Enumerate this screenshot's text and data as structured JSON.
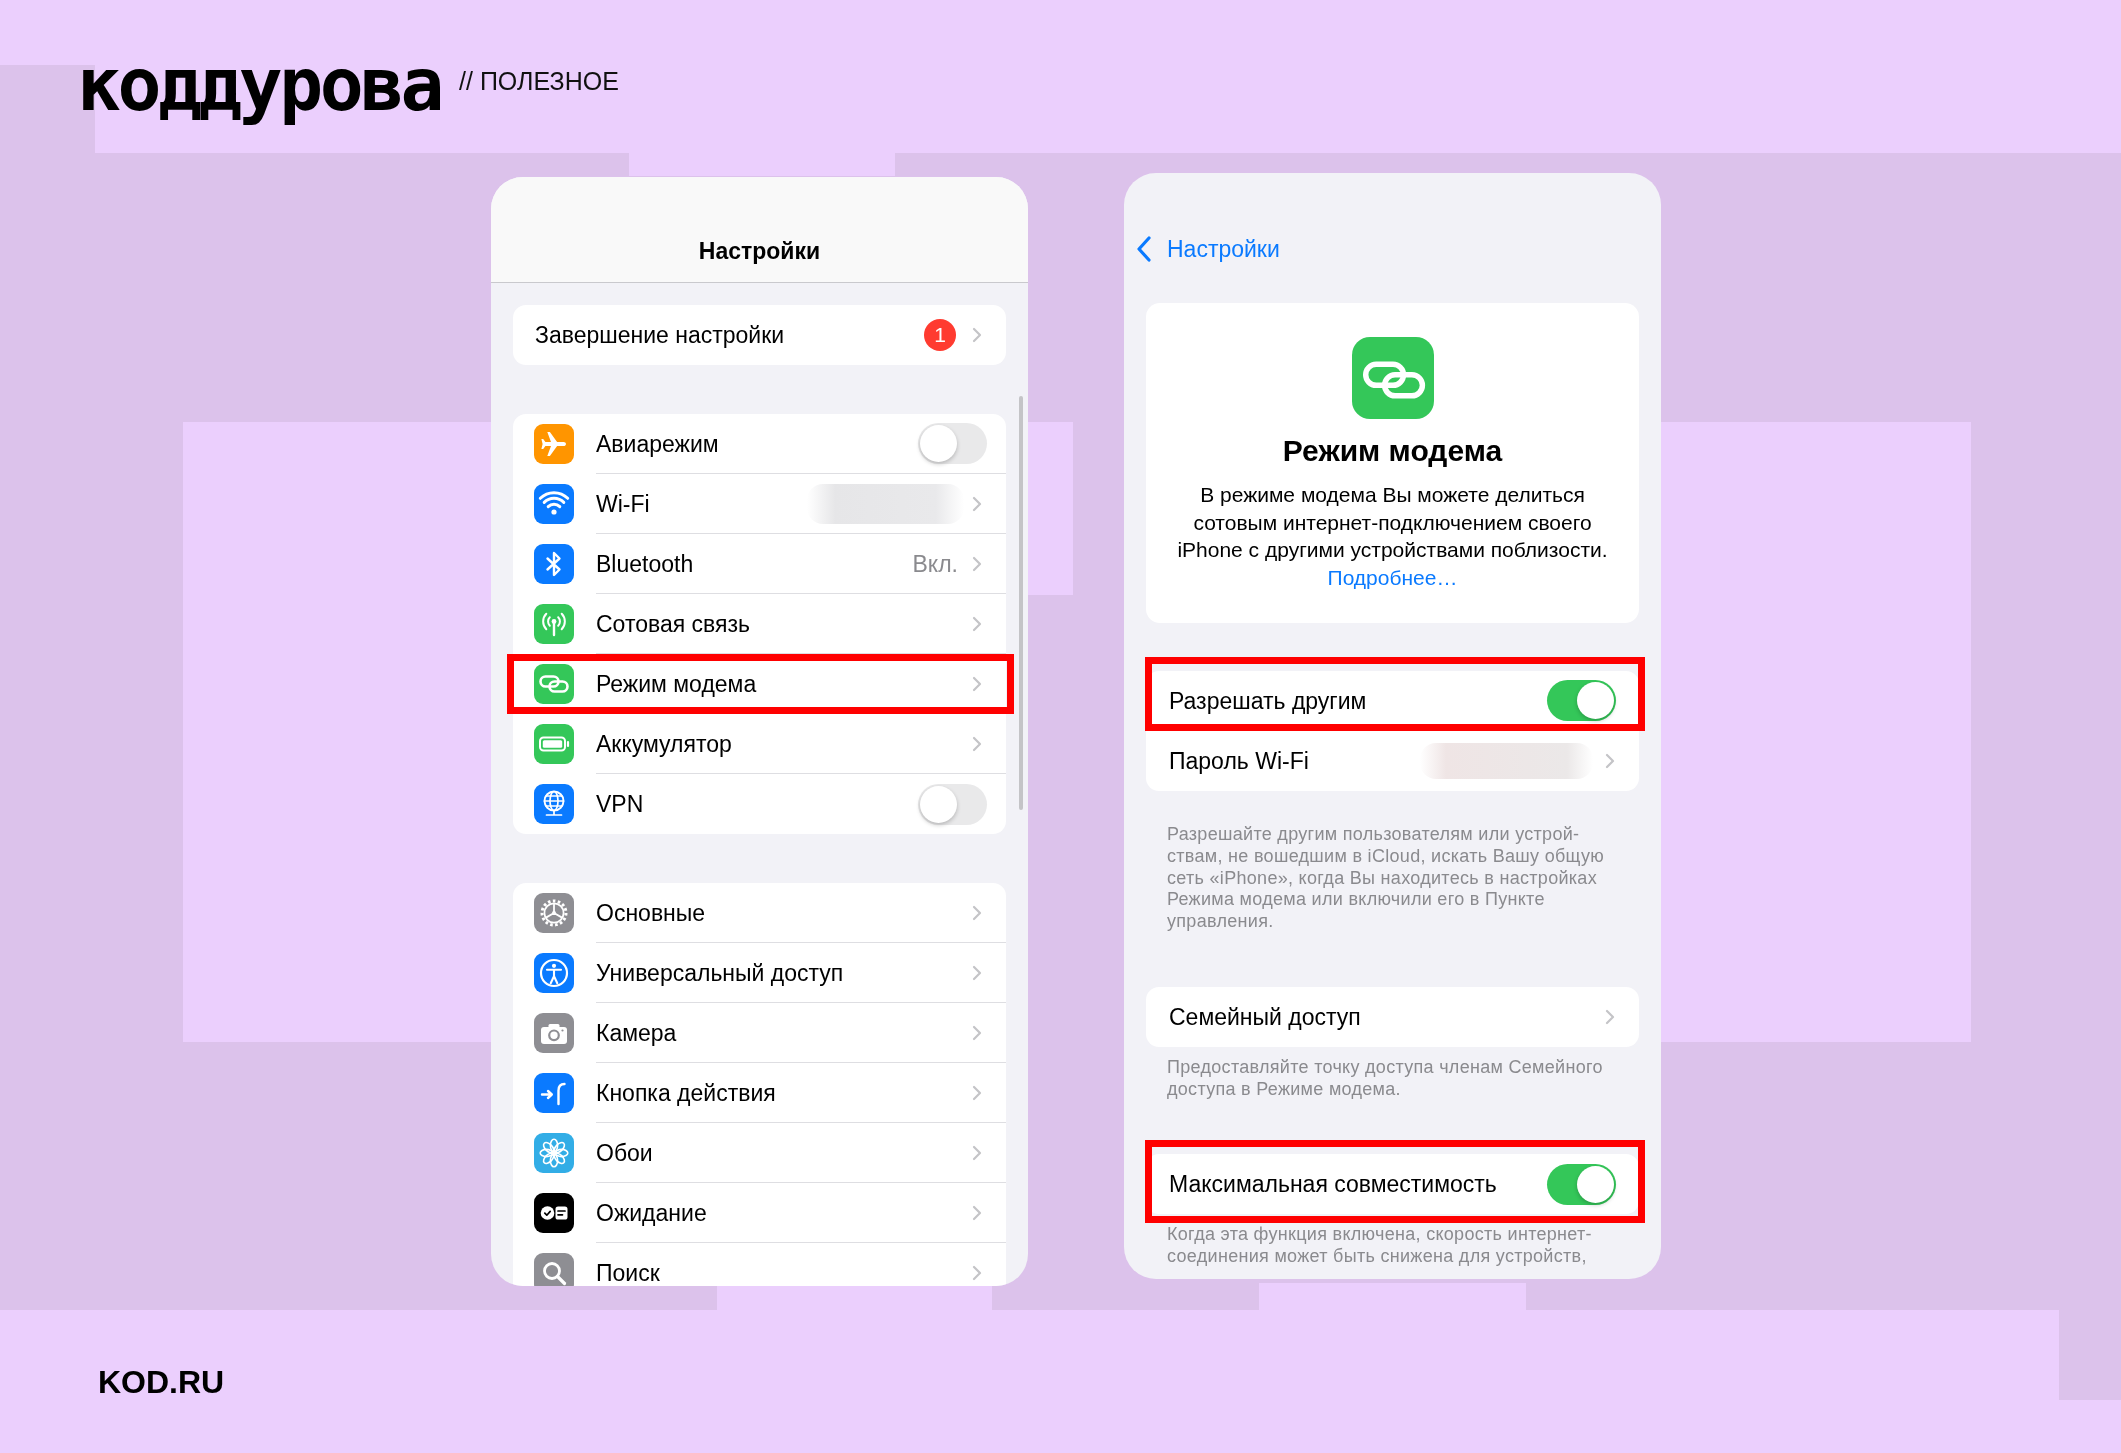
{
  "header": {
    "logo": "коддурова",
    "section": "// ПОЛЕЗНОЕ"
  },
  "settings_screen": {
    "title": "Настройки",
    "groups": [
      {
        "rows": [
          {
            "label": "Завершение настройки",
            "kind": "link",
            "badge": "1",
            "highlighted": false
          }
        ]
      },
      {
        "rows": [
          {
            "label": "Авиарежим",
            "kind": "toggle",
            "on": false,
            "color": "#ff9500",
            "highlighted": false
          },
          {
            "label": "Wi-Fi",
            "kind": "link",
            "value_blurred": true,
            "color": "#0a7aff",
            "highlighted": false
          },
          {
            "label": "Bluetooth",
            "kind": "link",
            "value": "Вкл.",
            "color": "#0a7aff",
            "highlighted": false
          },
          {
            "label": "Сотовая связь",
            "kind": "link",
            "color": "#34c759",
            "highlighted": false
          },
          {
            "label": "Режим модема",
            "kind": "link",
            "color": "#34c759",
            "highlighted": true
          },
          {
            "label": "Аккумулятор",
            "kind": "link",
            "color": "#34c759",
            "highlighted": false
          },
          {
            "label": "VPN",
            "kind": "toggle",
            "on": false,
            "color": "#0a7aff",
            "highlighted": false
          }
        ]
      },
      {
        "rows": [
          {
            "label": "Основные",
            "kind": "link",
            "color": "#8e8e93",
            "highlighted": false
          },
          {
            "label": "Универсальный доступ",
            "kind": "link",
            "color": "#0a7aff",
            "highlighted": false
          },
          {
            "label": "Камера",
            "kind": "link",
            "color": "#8e8e93",
            "highlighted": false
          },
          {
            "label": "Кнопка действия",
            "kind": "link",
            "color": "#0a7aff",
            "highlighted": false
          },
          {
            "label": "Обои",
            "kind": "link",
            "color": "#32ade6",
            "highlighted": false
          },
          {
            "label": "Ожидание",
            "kind": "link",
            "color": "#000000",
            "highlighted": false
          },
          {
            "label": "Поиск",
            "kind": "link",
            "color": "#8e8e93",
            "highlighted": false
          }
        ]
      }
    ]
  },
  "hotspot_screen": {
    "back_label": "Настройки",
    "hero": {
      "title": "Режим модема",
      "description": "В режиме модема Вы можете делиться\nсотовым интернет-подключением своего\niPhone с другими устройствами поблизости.",
      "link": "Подробнее…"
    },
    "sections": [
      {
        "rows": [
          {
            "label": "Разрешать другим",
            "kind": "toggle",
            "on": true,
            "highlighted": true
          },
          {
            "label": "Пароль Wi-Fi",
            "kind": "link",
            "value_blurred": true,
            "highlighted": false
          }
        ],
        "footer": "Разрешайте другим пользователям или устрой-\nствам, не вошедшим в iCloud, искать Вашу общую\nсеть «iPhone», когда Вы находитесь в настройках\nРежима модема или включили его в Пункте\nуправления."
      },
      {
        "rows": [
          {
            "label": "Семейный доступ",
            "kind": "link",
            "highlighted": false
          }
        ],
        "footer": "Предоставляйте точку доступа членам Семейного\nдоступа в Режиме модема."
      },
      {
        "rows": [
          {
            "label": "Максимальная совместимость",
            "kind": "toggle",
            "on": true,
            "highlighted": true
          }
        ],
        "footer": "Когда эта функция включена, скорость интернет-\nсоединения может быть снижена для устройств,"
      }
    ]
  },
  "footer": {
    "site": "KOD.RU"
  }
}
